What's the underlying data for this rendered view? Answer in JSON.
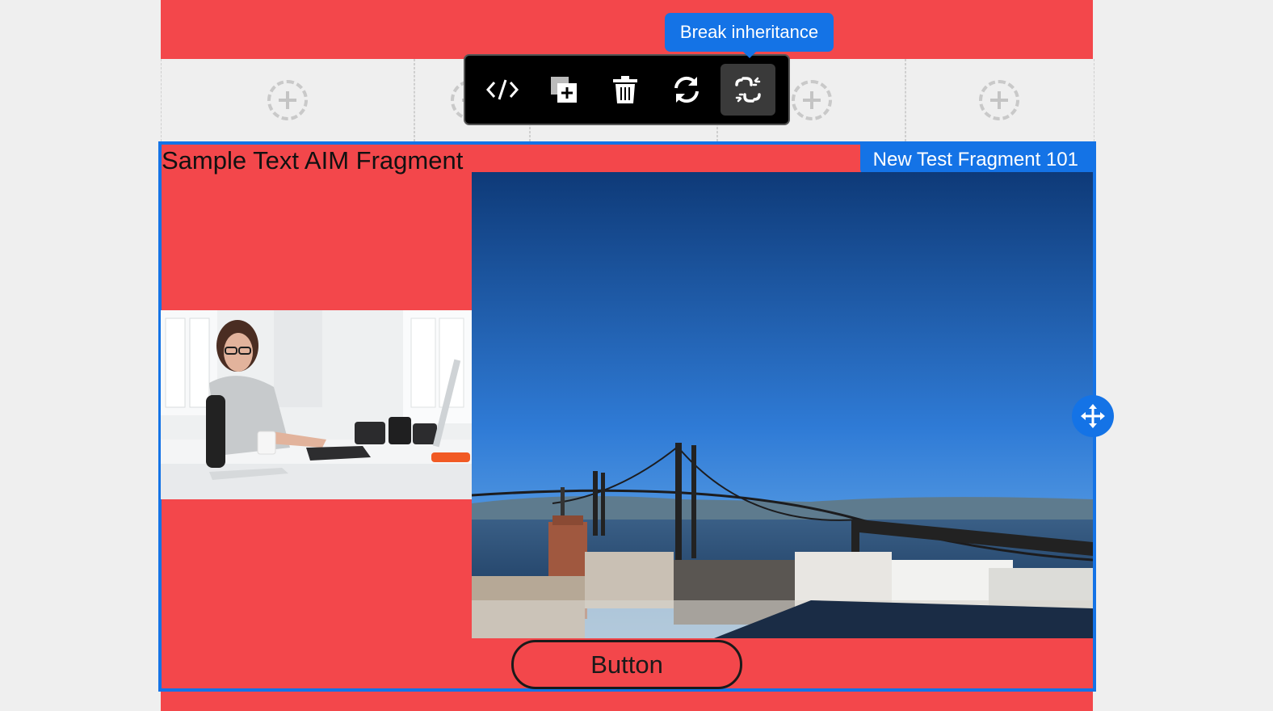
{
  "fragment": {
    "sample_text": "Sample Text AIM Fragment",
    "name_label": "New Test Fragment 101",
    "button_label": "Button"
  },
  "toolbar": {
    "items": [
      {
        "icon": "code-icon"
      },
      {
        "icon": "duplicate-icon"
      },
      {
        "icon": "trash-icon"
      },
      {
        "icon": "refresh-icon"
      },
      {
        "icon": "break-link-icon",
        "active": true
      }
    ],
    "tooltip": "Break inheritance"
  },
  "colors": {
    "accent": "#1473e6",
    "section_background": "#f3474b",
    "toolbar_background": "#000000"
  }
}
